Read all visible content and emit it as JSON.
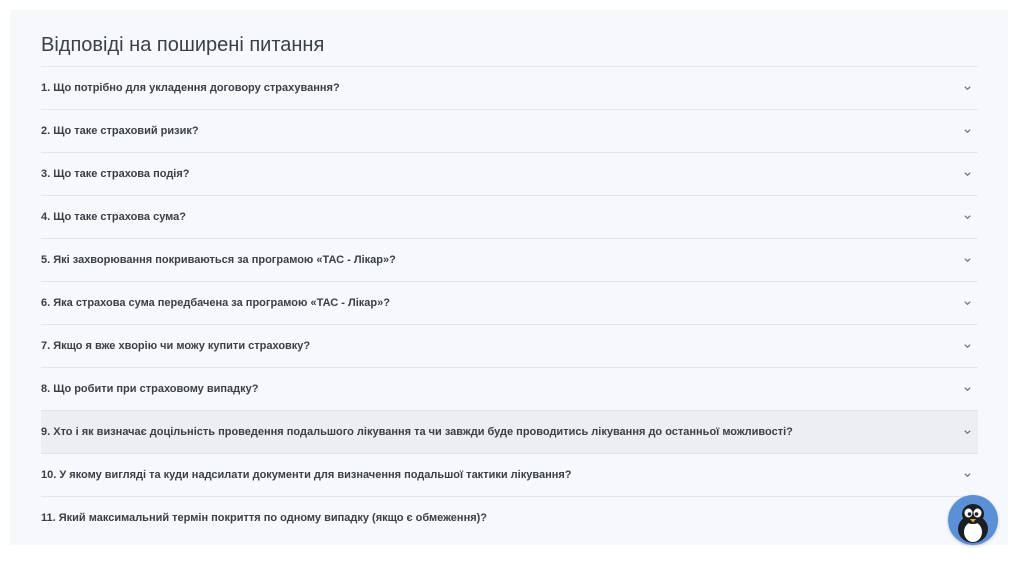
{
  "faq": {
    "title": "Відповіді на поширені питання",
    "items": [
      {
        "question": "1. Що потрібно для укладення договору страхування?"
      },
      {
        "question": "2. Що таке страховий ризик?"
      },
      {
        "question": "3. Що таке страхова подія?"
      },
      {
        "question": "4. Що таке страхова сума?"
      },
      {
        "question": "5. Які захворювання покриваються за програмою «ТАС - Лікар»?"
      },
      {
        "question": "6. Яка страхова сума передбачена за програмою «ТАС - Лікар»?"
      },
      {
        "question": "7. Якщо я вже хворію чи можу купити страховку?"
      },
      {
        "question": "8. Що робити при страховому випадку?"
      },
      {
        "question": "9. Хто і як визначає доцільність проведення подальшого лікування та чи завжди буде проводитись лікування до останньої можливості?"
      },
      {
        "question": "10. У якому вигляді та куди надсилати документи для визначення подальшої тактики лікування?"
      },
      {
        "question": "11. Який максимальний термін покриття по одному випадку (якщо є обмеження)?"
      }
    ],
    "highlighted_index": 8,
    "expand_icon": "chevron-down-icon"
  },
  "chat_widget": {
    "icon": "penguin-mascot-icon",
    "color": "#5b8fd6"
  }
}
